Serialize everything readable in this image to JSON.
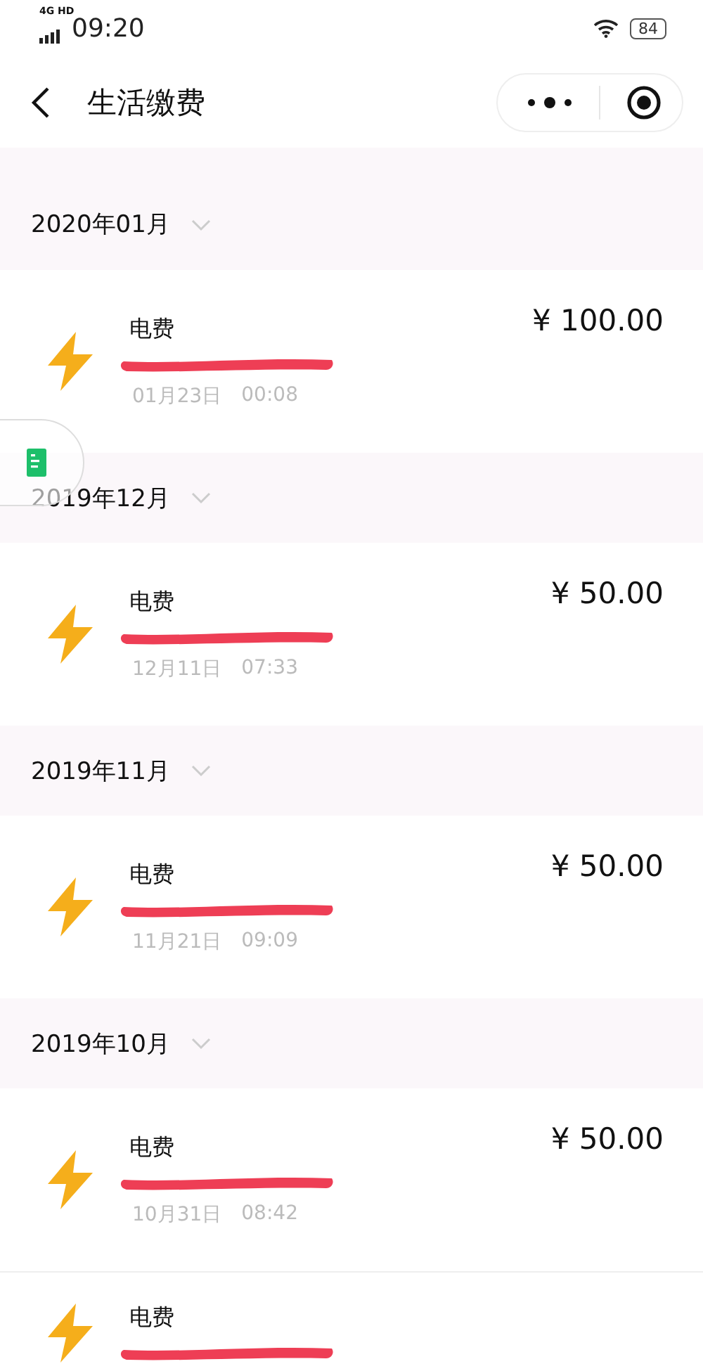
{
  "status_bar": {
    "network": "4G HD",
    "time": "09:20",
    "battery": "84"
  },
  "nav": {
    "title": "生活缴费"
  },
  "months": [
    {
      "label": "2020年01月",
      "items": [
        {
          "title": "电费",
          "amount": "¥ 100.00",
          "date": "01月23日",
          "time": "00:08"
        }
      ]
    },
    {
      "label": "2019年12月",
      "items": [
        {
          "title": "电费",
          "amount": "¥ 50.00",
          "date": "12月11日",
          "time": "07:33"
        }
      ]
    },
    {
      "label": "2019年11月",
      "items": [
        {
          "title": "电费",
          "amount": "¥ 50.00",
          "date": "11月21日",
          "time": "09:09"
        }
      ]
    },
    {
      "label": "2019年10月",
      "items": [
        {
          "title": "电费",
          "amount": "¥ 50.00",
          "date": "10月31日",
          "time": "08:42"
        },
        {
          "title": "电费"
        }
      ]
    }
  ]
}
